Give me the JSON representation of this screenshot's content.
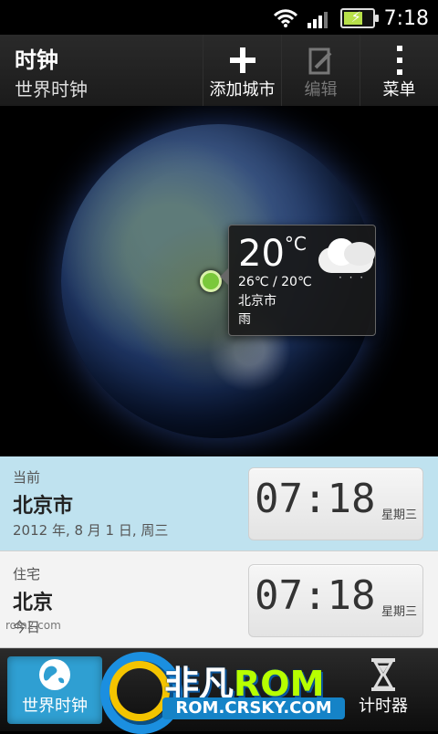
{
  "status": {
    "time": "7:18"
  },
  "header": {
    "title": "时钟",
    "subtitle": "世界时钟",
    "actions": [
      {
        "label": "添加城市",
        "icon": "plus-icon"
      },
      {
        "label": "编辑",
        "icon": "edit-icon"
      },
      {
        "label": "菜单",
        "icon": "menu-dots-icon"
      }
    ]
  },
  "weather": {
    "temperature": "20",
    "unit": "°C",
    "range": "26℃ / 20℃",
    "city": "北京市",
    "condition": "雨",
    "icon": "rain-cloud-icon"
  },
  "cities": [
    {
      "label": "当前",
      "name": "北京市",
      "date": "2012 年, 8 月 1 日, 周三",
      "time": "07:18",
      "weekday": "星期三"
    },
    {
      "label": "住宅",
      "name": "北京",
      "date": "今日",
      "time": "07:18",
      "weekday": "星期三"
    }
  ],
  "tabs": [
    {
      "label": "世界时钟",
      "icon": "globe-icon",
      "active": true
    },
    {
      "label": "计时器",
      "icon": "hourglass-icon",
      "active": false
    }
  ],
  "watermark": {
    "small": "rom2.com",
    "brand_left": "非凡",
    "brand_right": "ROM",
    "site": "ROM.CRSKY.COM"
  }
}
